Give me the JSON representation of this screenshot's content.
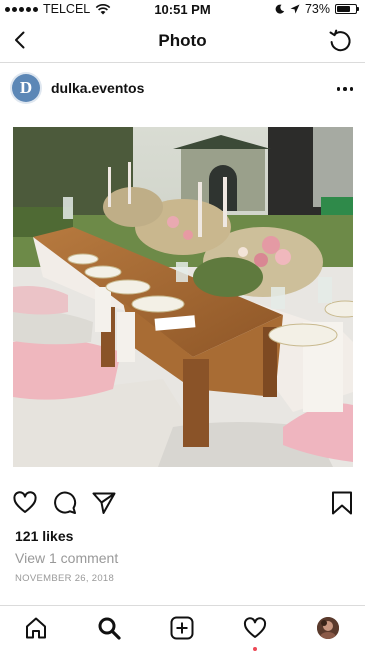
{
  "status_bar": {
    "carrier": "TELCEL",
    "time": "10:51 PM",
    "battery": "73%",
    "battery_level": 0.73,
    "icons": [
      "wifi-icon",
      "moon-icon",
      "location-arrow-icon",
      "battery-icon"
    ]
  },
  "header": {
    "title": "Photo",
    "back_icon": "chevron-left-icon",
    "refresh_icon": "refresh-icon"
  },
  "post": {
    "avatar_letter": "D",
    "username": "dulka.eventos",
    "more_icon": "more-horizontal-icon",
    "likes": "121 likes",
    "comments_link": "View 1 comment",
    "date": "NOVEMBER 26, 2018",
    "actions": [
      "heart-icon",
      "comment-icon",
      "share-icon",
      "bookmark-icon"
    ]
  },
  "tab_bar": {
    "items": [
      "home-icon",
      "search-icon",
      "add-post-icon",
      "activity-heart-icon",
      "profile-avatar"
    ]
  },
  "colors": {
    "accent_blue": "#5c87b6",
    "notification_red": "#ed4956",
    "muted_text": "#999999",
    "divider": "#dbdbdb"
  }
}
